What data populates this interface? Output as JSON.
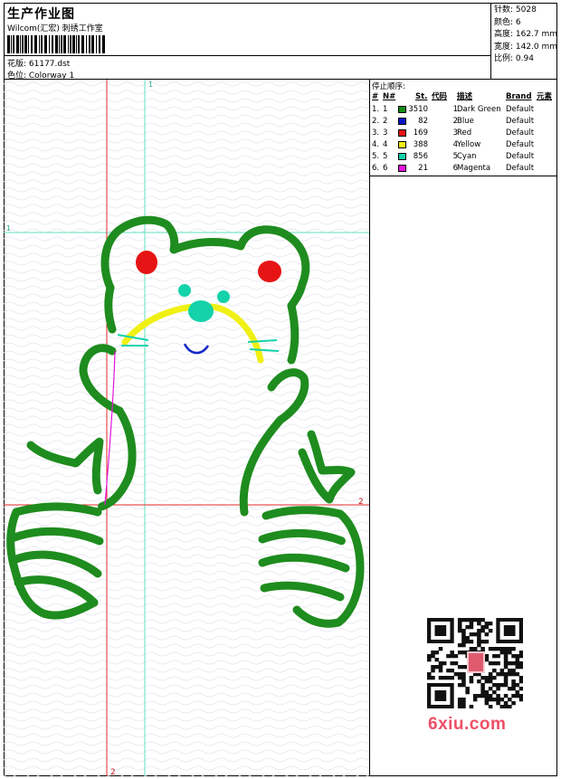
{
  "header": {
    "title": "生产作业图",
    "subtitle": "Wilcom(汇宏) 刺绣工作室",
    "design_label": "花版: 61177.dst",
    "colorway_label": "色位:  Colorway 1"
  },
  "stats": {
    "stitches": "针数: 5028",
    "colors": "颜色: 6",
    "height": "高度: 162.7 mm",
    "width": "宽度: 142.0 mm",
    "scale": "比例: 0.94"
  },
  "sequence": {
    "title": "停止顺序:",
    "headers": [
      "#",
      "N#",
      "St.",
      "代码",
      "描述",
      "Brand",
      "元素"
    ],
    "rows": [
      {
        "idx": "1.",
        "n": "1",
        "st": "3510",
        "code": "1",
        "desc": "Dark Green",
        "brand": "Default",
        "color": "#148c14"
      },
      {
        "idx": "2.",
        "n": "2",
        "st": "82",
        "code": "2",
        "desc": "Blue",
        "brand": "Default",
        "color": "#0a14c8"
      },
      {
        "idx": "3.",
        "n": "3",
        "st": "169",
        "code": "3",
        "desc": "Red",
        "brand": "Default",
        "color": "#e61414"
      },
      {
        "idx": "4.",
        "n": "4",
        "st": "388",
        "code": "4",
        "desc": "Yellow",
        "brand": "Default",
        "color": "#f0f014"
      },
      {
        "idx": "5.",
        "n": "5",
        "st": "856",
        "code": "5",
        "desc": "Cyan",
        "brand": "Default",
        "color": "#14d2aa"
      },
      {
        "idx": "6.",
        "n": "6",
        "st": "21",
        "code": "6",
        "desc": "Magenta",
        "brand": "Default",
        "color": "#e614dc"
      }
    ]
  },
  "guides": {
    "cyan_vertical": "1",
    "cyan_horizontal": "1",
    "red_horizontal": "2",
    "red_vertical": "2"
  },
  "colors": {
    "green": "#1e8c1e",
    "blue": "#1428c8",
    "red": "#e61414",
    "yellow": "#f0f014",
    "cyan": "#14d2aa",
    "magenta": "#e614dc",
    "guide_cyan": "#5fe0c0",
    "guide_red": "#e62828",
    "watermark": "#ee4f66"
  },
  "watermark": {
    "text": "6xiu.com"
  }
}
